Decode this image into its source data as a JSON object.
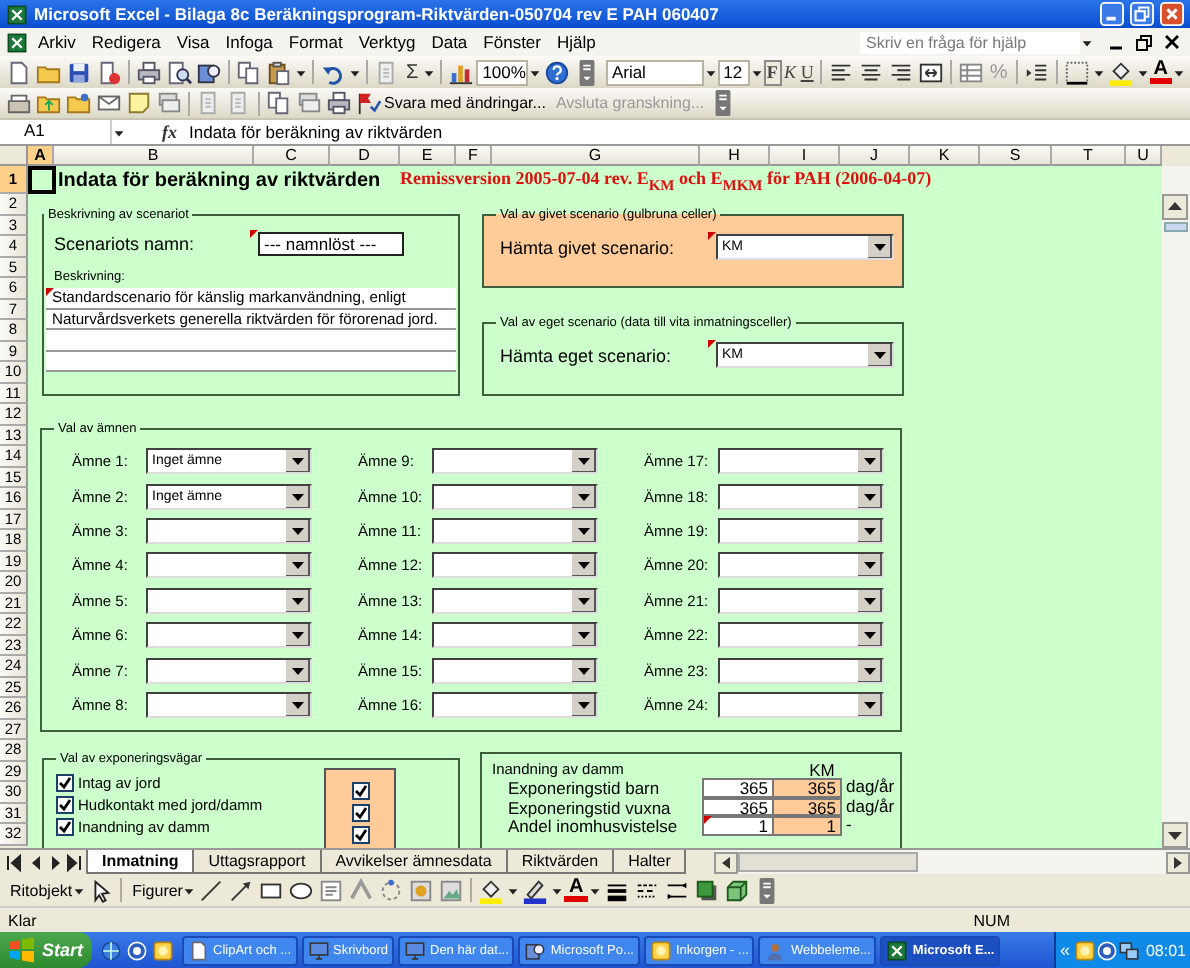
{
  "window": {
    "title": "Microsoft Excel - Bilaga 8c Beräkningsprogram-Riktvärden-050704 rev E PAH 060407"
  },
  "menu": {
    "items": [
      "Arkiv",
      "Redigera",
      "Visa",
      "Infoga",
      "Format",
      "Verktyg",
      "Data",
      "Fönster",
      "Hjälp"
    ],
    "help_placeholder": "Skriv en fråga för hjälp"
  },
  "standard_toolbar": {
    "autosum": "Σ",
    "zoom": "100%",
    "font": "Arial",
    "font_size": "12",
    "style_buttons": [
      "F",
      "K",
      "U"
    ],
    "percent": "%",
    "font_color": "A"
  },
  "review_toolbar": {
    "reply": "Svara med ändringar...",
    "end_review": "Avsluta granskning..."
  },
  "formula_bar": {
    "name_box": "A1",
    "fx": "fx",
    "formula": "Indata för beräkning av riktvärden"
  },
  "columns": [
    {
      "label": "A",
      "selected": true
    },
    {
      "label": "B",
      "selected": false
    },
    {
      "label": "C",
      "selected": false
    },
    {
      "label": "D",
      "selected": false
    },
    {
      "label": "E",
      "selected": false
    },
    {
      "label": "F",
      "selected": false
    },
    {
      "label": "G",
      "selected": false
    },
    {
      "label": "H",
      "selected": false
    },
    {
      "label": "I",
      "selected": false
    },
    {
      "label": "J",
      "selected": false
    },
    {
      "label": "K",
      "selected": false
    },
    {
      "label": "S",
      "selected": false
    },
    {
      "label": "T",
      "selected": false
    },
    {
      "label": "U",
      "selected": false
    }
  ],
  "rows": [
    {
      "label": "1",
      "selected": true
    },
    {
      "label": "2",
      "selected": false
    },
    {
      "label": "3",
      "selected": false
    },
    {
      "label": "4",
      "selected": false
    },
    {
      "label": "5",
      "selected": false
    },
    {
      "label": "6",
      "selected": false
    },
    {
      "label": "7",
      "selected": false
    },
    {
      "label": "8",
      "selected": false
    },
    {
      "label": "9",
      "selected": false
    },
    {
      "label": "10",
      "selected": false
    },
    {
      "label": "11",
      "selected": false
    },
    {
      "label": "12",
      "selected": false
    },
    {
      "label": "13",
      "selected": false
    },
    {
      "label": "14",
      "selected": false
    },
    {
      "label": "15",
      "selected": false
    },
    {
      "label": "16",
      "selected": false
    },
    {
      "label": "17",
      "selected": false
    },
    {
      "label": "18",
      "selected": false
    },
    {
      "label": "19",
      "selected": false
    },
    {
      "label": "20",
      "selected": false
    },
    {
      "label": "21",
      "selected": false
    },
    {
      "label": "22",
      "selected": false
    },
    {
      "label": "23",
      "selected": false
    },
    {
      "label": "24",
      "selected": false
    },
    {
      "label": "25",
      "selected": false
    },
    {
      "label": "26",
      "selected": false
    },
    {
      "label": "27",
      "selected": false
    },
    {
      "label": "28",
      "selected": false
    },
    {
      "label": "29",
      "selected": false
    },
    {
      "label": "30",
      "selected": false
    },
    {
      "label": "31",
      "selected": false
    },
    {
      "label": "32",
      "selected": false
    }
  ],
  "sheet": {
    "title": "Indata för beräkning av riktvärden",
    "version": "Remissversion 2005-07-04 rev. E$_{KM}$ och E$_{MKM}$ för PAH (2006-04-07)",
    "scenario": {
      "title": "Beskrivning av scenariot",
      "name_label": "Scenariots namn:",
      "name_value": "--- namnlöst ---",
      "name_has_comment": true,
      "description_label": "Beskrivning:",
      "description_lines": [
        {
          "text": "Standardscenario för känslig markanvändning, enligt",
          "has_comment": true
        },
        {
          "text": "Naturvårdsverkets generella riktvärden för förorenad jord.",
          "has_comment": false
        },
        {
          "has_comment": false
        },
        {
          "has_comment": false
        }
      ]
    },
    "given_scenario": {
      "title": "Val av givet scenario (gulbruna celler)",
      "label": "Hämta givet scenario:",
      "value": "KM",
      "has_comment": true
    },
    "own_scenario": {
      "title": "Val av eget scenario (data till vita inmatningsceller)",
      "label": "Hämta eget scenario:",
      "value": "KM",
      "has_comment": true
    },
    "substances": {
      "title": "Val av ämnen",
      "items": [
        {
          "label": "Ämne 1:",
          "value": "Inget ämne"
        },
        {
          "label": "Ämne 2:",
          "value": "Inget ämne"
        },
        {
          "label": "Ämne 3:"
        },
        {
          "label": "Ämne 4:"
        },
        {
          "label": "Ämne 5:"
        },
        {
          "label": "Ämne 6:"
        },
        {
          "label": "Ämne 7:"
        },
        {
          "label": "Ämne 8:"
        },
        {
          "label": "Ämne 9:"
        },
        {
          "label": "Ämne 10:"
        },
        {
          "label": "Ämne 11:"
        },
        {
          "label": "Ämne 12:"
        },
        {
          "label": "Ämne 13:"
        },
        {
          "label": "Ämne 14:"
        },
        {
          "label": "Ämne 15:"
        },
        {
          "label": "Ämne 16:"
        },
        {
          "label": "Ämne 17:"
        },
        {
          "label": "Ämne 18:"
        },
        {
          "label": "Ämne 19:"
        },
        {
          "label": "Ämne 20:"
        },
        {
          "label": "Ämne 21:"
        },
        {
          "label": "Ämne 22:"
        },
        {
          "label": "Ämne 23:"
        },
        {
          "label": "Ämne 24:"
        }
      ]
    },
    "exposure_paths": {
      "title": "Val av exponeringsvägar",
      "items": [
        {
          "label": "Intag av jord",
          "checked": true,
          "given_checked": true
        },
        {
          "label": "Hudkontakt med jord/damm",
          "checked": true,
          "given_checked": true
        },
        {
          "label": "Inandning av damm",
          "checked": true,
          "given_checked": true
        }
      ]
    },
    "inhalation": {
      "title": "Inandning av damm",
      "scenario": "KM",
      "rows": [
        {
          "label": "Exponeringstid barn",
          "own": "365",
          "given": "365",
          "unit": "dag/år",
          "has_comment": false
        },
        {
          "label": "Exponeringstid vuxna",
          "own": "365",
          "given": "365",
          "unit": "dag/år",
          "has_comment": false
        },
        {
          "label": "Andel inomhusvistelse",
          "own": "1",
          "given": "1",
          "unit": "-",
          "has_comment": true
        }
      ]
    }
  },
  "sheet_tabs": [
    {
      "label": "Inmatning",
      "selected": true
    },
    {
      "label": "Uttagsrapport",
      "selected": false
    },
    {
      "label": "Avvikelser ämnesdata",
      "selected": false
    },
    {
      "label": "Riktvärden",
      "selected": false
    },
    {
      "label": "Halter",
      "selected": false
    }
  ],
  "drawing_toolbar": {
    "draw_menu": "Ritobjekt",
    "shapes_menu": "Figurer",
    "font_color": "A"
  },
  "status_bar": {
    "status": "Klar",
    "num_lock": "NUM"
  },
  "taskbar": {
    "start": "Start",
    "tasks": [
      {
        "label": "ClipArt och ...",
        "selected": false
      },
      {
        "label": "Skrivbord",
        "selected": false
      },
      {
        "label": "Den här dat...",
        "selected": false
      },
      {
        "label": "Microsoft Po...",
        "selected": false
      },
      {
        "label": "Inkorgen - ...",
        "selected": false
      },
      {
        "label": "Webbeleme...",
        "selected": false
      },
      {
        "label": "Microsoft E...",
        "selected": true
      }
    ],
    "tray_expand": "«",
    "clock": "08:01"
  }
}
